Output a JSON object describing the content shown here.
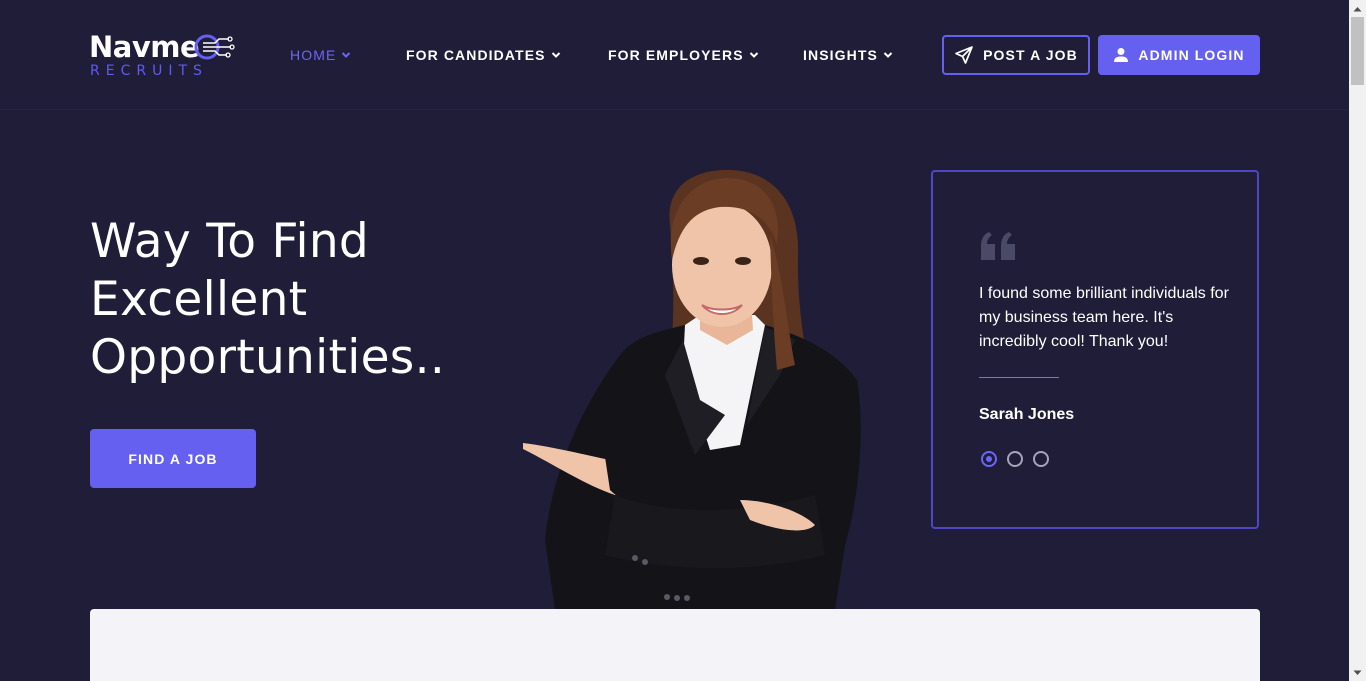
{
  "brand": {
    "name": "Navme",
    "tagline": "RECRUITS"
  },
  "nav": {
    "items": [
      {
        "label": "HOME",
        "active": true
      },
      {
        "label": "FOR CANDIDATES",
        "active": false
      },
      {
        "label": "FOR EMPLOYERS",
        "active": false
      },
      {
        "label": "INSIGHTS",
        "active": false
      }
    ],
    "post_job_label": "POST A JOB",
    "admin_login_label": "ADMIN LOGIN"
  },
  "hero": {
    "title_lines": [
      "Way To Find",
      "Excellent",
      "Opportunities.."
    ],
    "cta_label": "FIND A JOB"
  },
  "testimonial": {
    "quote": "I found some brilliant individuals for my business team here. It's incredibly cool! Thank you!",
    "author": "Sarah Jones",
    "slide_count": 3,
    "active_slide": 1
  },
  "colors": {
    "background": "#1f1d38",
    "accent": "#6560f0",
    "active_nav": "#6c66f7",
    "panel": "#f3f3f8"
  },
  "icons": {
    "post_job": "paper-plane-icon",
    "admin_login": "user-icon",
    "nav_dropdown": "chevron-down-icon",
    "testimonial": "quote-icon"
  }
}
